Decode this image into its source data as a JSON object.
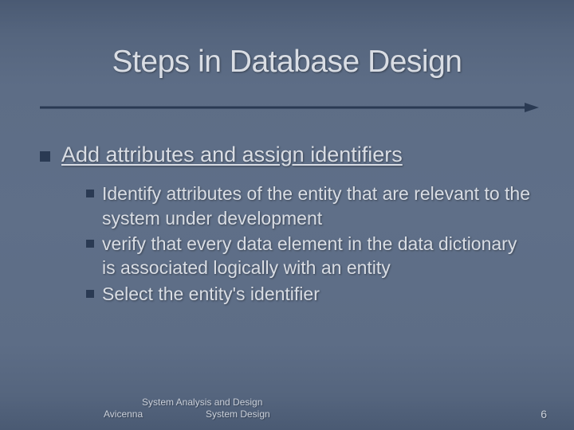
{
  "title": "Steps in Database Design",
  "main_point": "Add attributes and assign identifiers",
  "sub_points": [
    "Identify attributes of the entity that are relevant to the system under development",
    "verify that every data element in the data dictionary is associated logically with an entity",
    "Select the entity's identifier"
  ],
  "footer": {
    "line1": "System Analysis and Design",
    "line2_left": "Avicenna",
    "line2_right": "System Design",
    "page_number": "6"
  },
  "colors": {
    "bullet": "#2a3a53",
    "text": "#d9dde4",
    "bg_mid": "#5f6f88"
  }
}
